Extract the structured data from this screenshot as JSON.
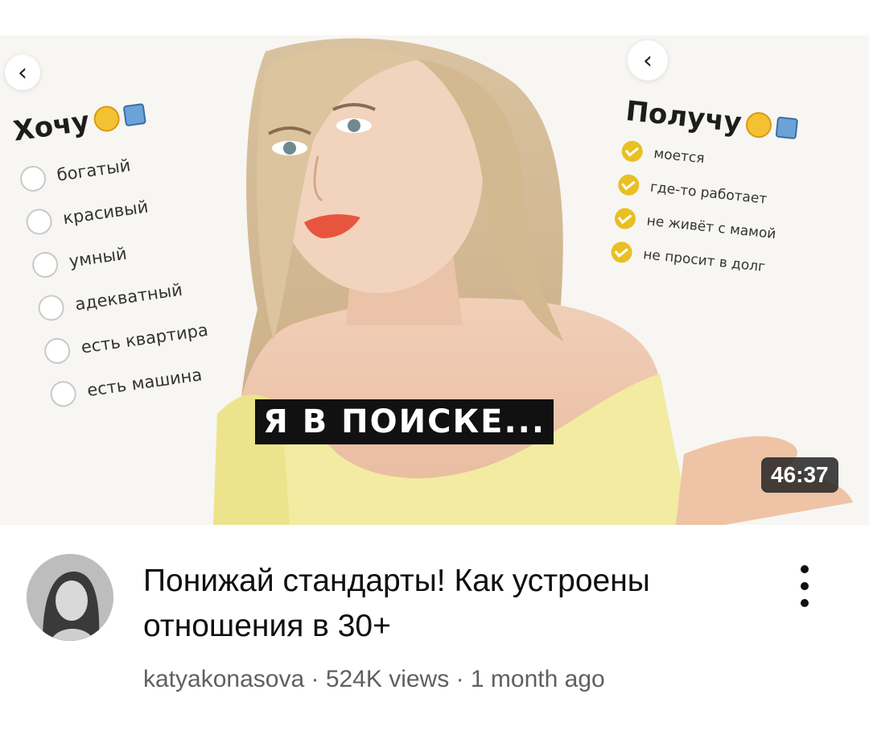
{
  "thumbnail": {
    "left_panel": {
      "title": "Хочу",
      "items": [
        "богатый",
        "красивый",
        "умный",
        "адекватный",
        "есть квартира",
        "есть машина"
      ]
    },
    "right_panel": {
      "title": "Получу",
      "items": [
        "моется",
        "где-то работает",
        "не живёт с мамой",
        "не просит в долг"
      ]
    },
    "caption": "Я В ПОИСКЕ...",
    "duration": "46:37",
    "back_icon": "chevron-left-icon"
  },
  "video": {
    "title": "Понижай стандарты! Как устроены отношения в 30+",
    "channel": "katyakonasova",
    "separator": " · ",
    "views": "524K views",
    "age": "1 month ago"
  },
  "colors": {
    "check_accent": "#eabf22",
    "text_primary": "#0f0f0f",
    "text_secondary": "#606060",
    "top_yellow": "#f2eba1"
  }
}
